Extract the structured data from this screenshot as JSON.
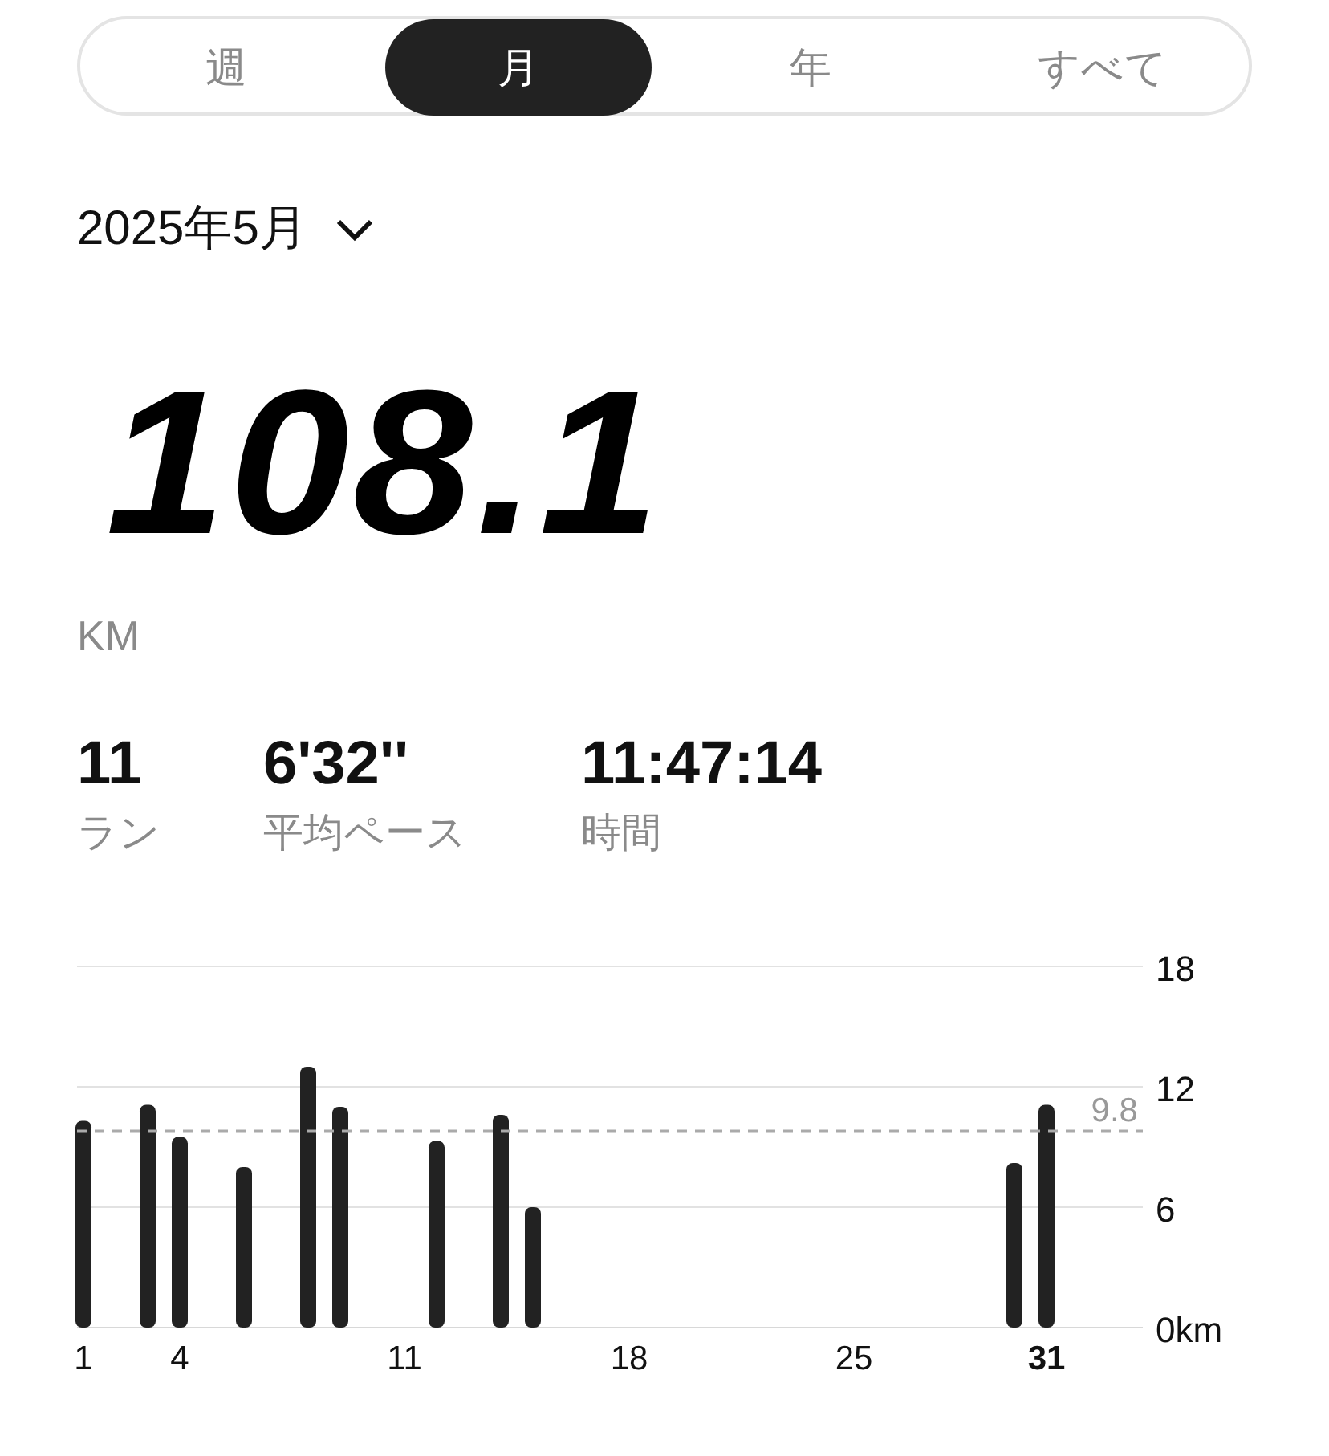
{
  "tabs": [
    {
      "label": "週",
      "selected": false
    },
    {
      "label": "月",
      "selected": true
    },
    {
      "label": "年",
      "selected": false
    },
    {
      "label": "すべて",
      "selected": false
    }
  ],
  "period": {
    "label": "2025年5月"
  },
  "total": {
    "value": "108.1",
    "unit": "KM"
  },
  "stats": [
    {
      "value": "11",
      "label": "ラン"
    },
    {
      "value": "6'32''",
      "label": "平均ペース"
    },
    {
      "value": "11:47:14",
      "label": "時間"
    }
  ],
  "chart_data": {
    "type": "bar",
    "x": [
      1,
      3,
      4,
      6,
      8,
      9,
      12,
      14,
      15,
      30,
      31
    ],
    "values": [
      10.3,
      11.1,
      9.5,
      8.0,
      13.0,
      11.0,
      9.3,
      10.6,
      6.0,
      8.2,
      11.1
    ],
    "xlim": [
      0.8,
      34
    ],
    "ylim": [
      0,
      18
    ],
    "yticks": [
      {
        "value": 0,
        "label": "0km"
      },
      6,
      12,
      18
    ],
    "xticks": [
      1,
      4,
      11,
      18,
      25,
      31
    ],
    "ref_lines": [
      {
        "axis": "y",
        "value": 9.8,
        "label": "9.8"
      }
    ]
  }
}
